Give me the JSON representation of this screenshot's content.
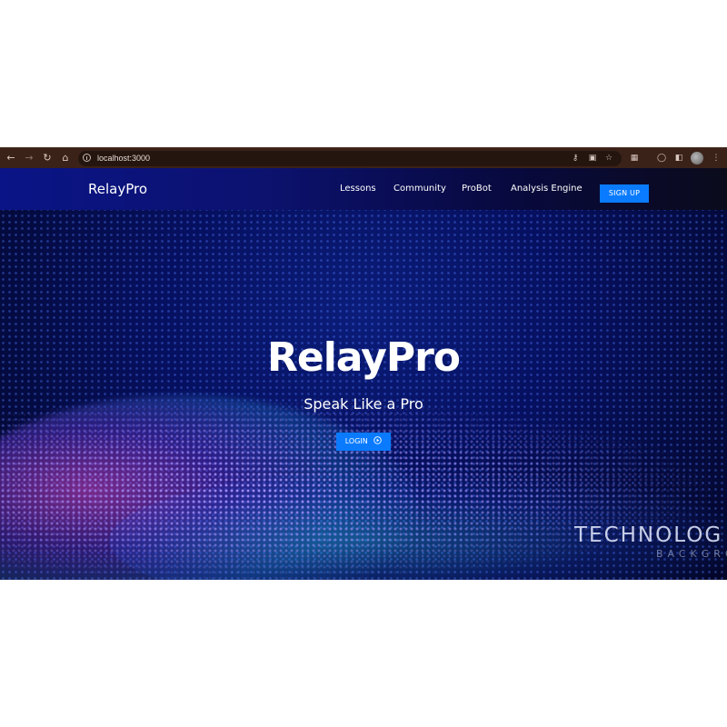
{
  "browser": {
    "url": "localhost:3000",
    "back_icon": "arrow-left-icon",
    "forward_icon": "arrow-right-icon",
    "reload_icon": "reload-icon",
    "home_icon": "home-icon",
    "info_icon": "info-icon",
    "key_icon": "key-icon",
    "cast_icon": "cast-icon",
    "star_icon": "star-icon",
    "extensions_icon": "puzzle-icon",
    "sync_icon": "sync-icon",
    "sidebar_icon": "sidebar-icon",
    "menu_icon": "kebab-menu-icon"
  },
  "navbar": {
    "brand": "RelayPro",
    "links": [
      "Lessons",
      "Community",
      "ProBot",
      "Analysis Engine"
    ],
    "signup_label": "SIGN UP"
  },
  "hero": {
    "title": "RelayPro",
    "subtitle": "Speak Like a Pro",
    "login_label": "LOGIN",
    "watermark_line1": "TECHNOLOG",
    "watermark_line2": "BACKGRO"
  },
  "colors": {
    "accent": "#0a7bff",
    "browser_bar": "#3b2219",
    "navbar_start": "#0a1486",
    "hero_background": "#061060"
  }
}
